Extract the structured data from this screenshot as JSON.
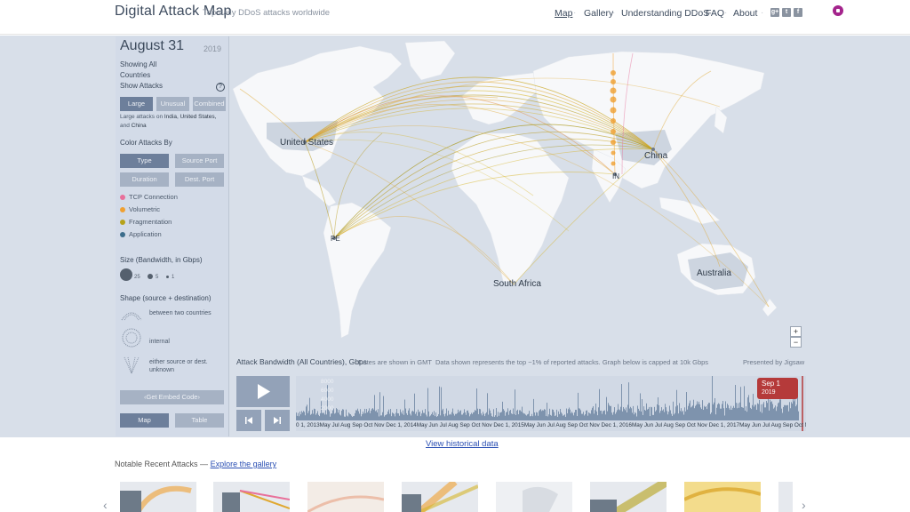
{
  "header": {
    "title": "Digital Attack Map",
    "tagline": "Top daily DDoS attacks worldwide",
    "nav": [
      "Map",
      "Gallery",
      "Understanding DDoS",
      "FAQ",
      "About"
    ],
    "social": [
      "g+",
      "t",
      "f"
    ],
    "colors": {
      "brand": "#3d4b5e",
      "avatar": "#a4248c"
    }
  },
  "panel": {
    "date": "August 31",
    "year": "2019",
    "showing": "Showing All",
    "countries": "Countries",
    "show_attacks": "Show Attacks",
    "help": "?",
    "attack_buttons": [
      "Large",
      "Unusual",
      "Combined"
    ],
    "large_note_prefix": "Large attacks on ",
    "large_note_countries": "India, United States,",
    "large_note_and": "and ",
    "large_note_last": "China",
    "color_by": "Color Attacks By",
    "color_buttons": [
      "Type",
      "Source Port",
      "Duration",
      "Dest. Port"
    ],
    "legend": [
      {
        "label": "TCP Connection",
        "color": "#e8709a"
      },
      {
        "label": "Volumetric",
        "color": "#f0a030"
      },
      {
        "label": "Fragmentation",
        "color": "#b6a21a"
      },
      {
        "label": "Application",
        "color": "#3c6d8c"
      }
    ],
    "size_title": "Size (Bandwidth, in Gbps)",
    "sizes": [
      "25",
      "5",
      "1"
    ],
    "shape_title": "Shape (source + destination)",
    "shapes": [
      "between two countries",
      "internal",
      "either source or dest. unknown"
    ],
    "embed": "‹Get Embed Code›",
    "view_buttons": [
      "Map",
      "Table"
    ]
  },
  "map": {
    "labels": [
      "United States",
      "China",
      "IN",
      "PE",
      "South Africa",
      "Australia"
    ],
    "zoom": [
      "+",
      "−"
    ]
  },
  "timeline": {
    "title": "Attack Bandwidth (All Countries), Gbps",
    "note1": "Dates are shown in GMT",
    "note2": "Data shown represents the top ~1% of reported attacks. Graph below is capped at 10k Gbps",
    "presented": "Presented by Jigsaw",
    "yticks": [
      "8000",
      "6000",
      "4000",
      "2000"
    ],
    "tooltip_date": "Sep 1",
    "tooltip_year": "2019",
    "axis_labels": "0 1, 2013May Jul Aug Sep Oct Nov Dec 1, 2014May Jun Jul Aug Sep Oct Nov Dec 1, 2015May Jun Jul Aug Sep Oct Nov Dec 1, 2016May Jun Jul Aug Sep Oct Nov Dec 1, 2017May Jun Jul Aug Sep Oct Nov Dec 1, 2018May Jun Jul Aug Sep Oct Nov Dec 1, 2019May Jun Jul Aug"
  },
  "footer": {
    "historical": "View historical data",
    "notable_prefix": "Notable Recent Attacks — ",
    "notable_link": "Explore the gallery"
  }
}
